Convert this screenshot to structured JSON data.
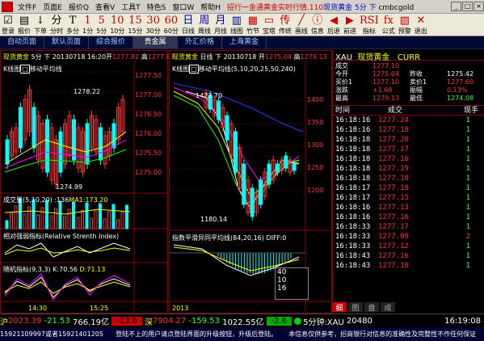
{
  "menu": {
    "items": [
      "文件F",
      "页面E",
      "报价Q",
      "查看V",
      "工具T",
      "特色S",
      "窗口W",
      "帮助H"
    ],
    "ticker_prefix": "招行一金通黄金实时行情.110",
    "ticker_link": "现货黄金",
    "ticker_period": "5分 下",
    "ticker_code": "cmbcgold"
  },
  "toolbar": {
    "buttons": [
      {
        "glyph": "☑",
        "label": "登录"
      },
      {
        "glyph": "▤",
        "label": "报价"
      },
      {
        "glyph": "↓",
        "label": "下单"
      },
      {
        "glyph": "分",
        "label": "分时"
      },
      {
        "glyph": "T",
        "label": "多分"
      },
      {
        "glyph": "1",
        "label": "1分"
      },
      {
        "glyph": "5",
        "label": "5分"
      },
      {
        "glyph": "10",
        "label": "10分"
      },
      {
        "glyph": "15",
        "label": "15分"
      },
      {
        "glyph": "30",
        "label": "30分"
      },
      {
        "glyph": "60",
        "label": "60分"
      },
      {
        "glyph": "日",
        "label": "日线"
      },
      {
        "glyph": "周",
        "label": "周线"
      },
      {
        "glyph": "月",
        "label": "月线"
      },
      {
        "glyph": "▥",
        "label": "线图"
      },
      {
        "glyph": "▦",
        "label": "竹节"
      },
      {
        "glyph": "▭",
        "label": "宝塔"
      },
      {
        "glyph": "传",
        "label": "传统"
      },
      {
        "glyph": "╱",
        "label": "画线"
      },
      {
        "glyph": "ⓘ",
        "label": "信息"
      },
      {
        "glyph": "◀",
        "label": "后退"
      },
      {
        "glyph": "▶",
        "label": "前进"
      },
      {
        "glyph": "RSI",
        "label": "指标"
      },
      {
        "glyph": "fx",
        "label": "公式"
      },
      {
        "glyph": "▨",
        "label": "预警"
      },
      {
        "glyph": "✕",
        "label": "退出"
      }
    ]
  },
  "tabs": [
    "自动页面",
    "默认页面",
    "综合报价",
    "贵金属",
    "外汇价格",
    "上海黄金"
  ],
  "active_tab": 3,
  "left_chart": {
    "header": {
      "name": "现货黄金",
      "period": "5分 下",
      "date": "20130718",
      "time": "16:20",
      "open_label": "开",
      "open": "1277.82",
      "high_label": "高",
      "high": "1277.87"
    },
    "ma_title": "K线图",
    "ma_name": "移动平均线",
    "ann_high": "1278.22",
    "ann_low": "1274.99",
    "yticks": [
      "1277.50",
      "1277.00",
      "1276.50",
      "1276.00",
      "1275.50",
      "1275.00"
    ],
    "vol_title": "成交量",
    "vol_params": "(5,10,20)",
    "vol_value": ":136",
    "vol_ma_label": "MA1:",
    "vol_ma": "173.20",
    "rsi_title": "相对强弱指标(Relative Strenth Index)",
    "kdj_title": "随机指标",
    "kdj_params": "(9,3,3)",
    "kdj_k": "K:70.56",
    "kdj_d": "D:71.13",
    "xticks": [
      "14:30",
      "15:25"
    ]
  },
  "mid_chart": {
    "header": {
      "name": "现货黄金",
      "period": "日线 下",
      "date": "20130718",
      "open_label": "开",
      "open": "1275.04",
      "high_label": "高",
      "high": "1279.13"
    },
    "ma_title": "K线图",
    "ma_name": "移动平均线",
    "ma_params": "(5,10,20,25,50,240)",
    "ann_high": "1423.70",
    "ann_low": "1180.14",
    "yticks": [
      "1400",
      "1350",
      "1300",
      "1250",
      "1200"
    ],
    "macd_title": "指数平滑异同平均线",
    "macd_params": "(84,20,16)",
    "macd_diff": "DIFF:0",
    "xtick": "2013",
    "popup": [
      "40",
      "10",
      "16"
    ]
  },
  "quote": {
    "code": "XAU",
    "name": "现货黄金",
    "curr": "CURR",
    "rows": [
      [
        {
          "k": "成交"
        },
        {
          "v": "1277.10",
          "c": "r"
        },
        {
          "k": ""
        },
        {
          "v": ""
        }
      ],
      [
        {
          "k": "今开"
        },
        {
          "v": "1275.04",
          "c": "r"
        },
        {
          "k": "昨收"
        },
        {
          "v": "1275.42",
          "c": "w"
        }
      ],
      [
        {
          "k": "买价1"
        },
        {
          "v": "1277.10",
          "c": "r"
        },
        {
          "k": "卖价1"
        },
        {
          "v": "1277.60",
          "c": "r"
        }
      ],
      [
        {
          "k": "涨跌"
        },
        {
          "v": "+1.68",
          "c": "r"
        },
        {
          "k": "振幅"
        },
        {
          "v": "0.13%",
          "c": "r"
        }
      ],
      [
        {
          "k": "最高"
        },
        {
          "v": "1279.13",
          "c": "r"
        },
        {
          "k": "最低"
        },
        {
          "v": "1274.08",
          "c": "g"
        }
      ]
    ],
    "trade_head": {
      "time": "时间",
      "price": "成交",
      "vol": "现手"
    },
    "trades": [
      [
        "16:18:16",
        "1277.24",
        "1"
      ],
      [
        "16:18:16",
        "1277.18",
        "1"
      ],
      [
        "16:18:18",
        "1277.20",
        "1"
      ],
      [
        "16:18:18",
        "1277.17",
        "1"
      ],
      [
        "16:18:18",
        "1277.16",
        "1"
      ],
      [
        "16:18:18",
        "1277.19",
        "1"
      ],
      [
        "16:18:18",
        "1277.18",
        "1"
      ],
      [
        "16:18:17",
        "1277.18",
        "1"
      ],
      [
        "16:18:17",
        "1277.15",
        "1"
      ],
      [
        "16:18:16",
        "1277.13",
        "1"
      ],
      [
        "16:18:16",
        "1277.16",
        "1"
      ],
      [
        "16:18:33",
        "1277.17",
        "1"
      ],
      [
        "16:18:33",
        "1277.09",
        "2"
      ],
      [
        "16:18:33",
        "1277.12",
        "1"
      ],
      [
        "16:18:43",
        "1277.16",
        "1"
      ],
      [
        "16:18:43",
        "1277.10",
        "1"
      ]
    ],
    "tabs": [
      "细",
      "图",
      "盘",
      "成"
    ]
  },
  "status": {
    "sh_label": "沪",
    "sh_index": "2023.39",
    "sh_change": "-21.53",
    "sh_amount": "766.19亿",
    "sh_box": "-13.6",
    "sz_label": "深",
    "sz_index": "7904.27",
    "sz_change": "-159.53",
    "sz_amount": "1022.55亿",
    "sz_box": "-2.6",
    "period_label": "5分钟:XAU",
    "period_value": "20480",
    "clock": "16:19:08",
    "phone": "15921109997或者15921401205",
    "notice": "登陆不上的用户请点登陆界面的升级按钮，升级后登陆。",
    "disclaimer": "本信息仅供参考，招商银行对信息的准确性及完整性不作任何保证"
  }
}
